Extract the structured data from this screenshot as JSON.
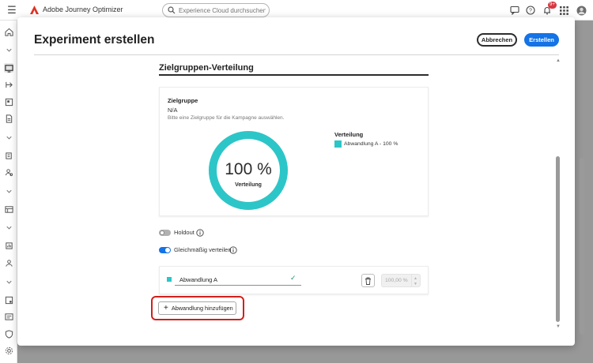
{
  "app": {
    "name": "Adobe Journey Optimizer",
    "search_placeholder": "Experience Cloud durchsuchen Str...",
    "notification_count": "9+"
  },
  "modal": {
    "title": "Experiment erstellen",
    "cancel_label": "Abbrechen",
    "create_label": "Erstellen"
  },
  "distribution": {
    "section_title": "Zielgruppen-Verteilung",
    "audience_label": "Zielgruppe",
    "audience_value": "N/A",
    "audience_hint": "Bitte eine Zielgruppe für die Kampagne auswählen.",
    "donut_value": "100 %",
    "donut_label": "Verteilung",
    "donut_fraction": 1.0,
    "legend_title": "Verteilung",
    "legend_entries": [
      {
        "label": "Abwandlung A - 100 %",
        "color": "#2cc6c8"
      }
    ]
  },
  "toggles": {
    "holdout_label": "Holdout",
    "holdout_on": false,
    "even_label": "Gleichmäßig verteilen",
    "even_on": true
  },
  "treatments": [
    {
      "name": "Abwandlung A",
      "percent": "100,00 %",
      "color": "#2cc6c8"
    }
  ],
  "add_treatment_label": "Abwandlung hinzufügen",
  "colors": {
    "accent": "#1473e6",
    "donut": "#2cc6c8",
    "highlight": "#d1201b"
  }
}
